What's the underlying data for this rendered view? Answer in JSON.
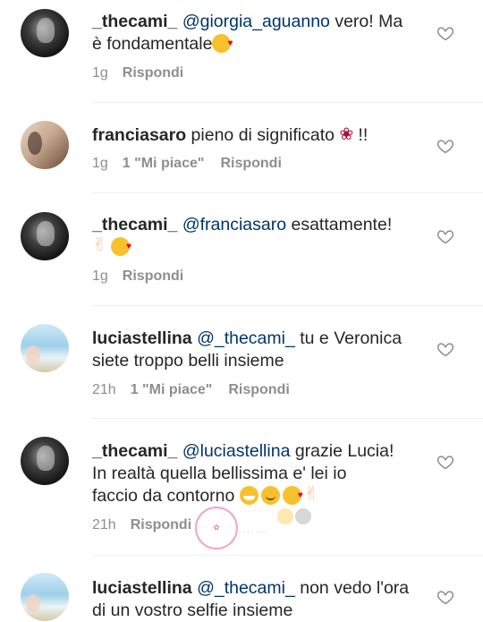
{
  "comments": [
    {
      "username": "_thecami_",
      "mention": "@giorgia_aguanno",
      "text_line1": " vero! Ma",
      "text_line2": "è fondamentale",
      "time": "1g",
      "likes": "",
      "reply": "Rispondi",
      "avatar": "dark"
    },
    {
      "username": "franciasaro",
      "mention": "",
      "text_line1": " pieno di significato ",
      "text_line1_end": "!!",
      "time": "1g",
      "likes": "1 \"Mi piace\"",
      "reply": "Rispondi",
      "avatar": "light"
    },
    {
      "username": "_thecami_",
      "mention": "@franciasaro",
      "text_line1": " esattamente!",
      "time": "1g",
      "likes": "",
      "reply": "Rispondi",
      "avatar": "dark"
    },
    {
      "username": "luciastellina",
      "mention": "@_thecami_",
      "text_line1": " tu e Veronica",
      "text_line2": "siete troppo belli insieme",
      "time": "21h",
      "likes": "1 \"Mi piace\"",
      "reply": "Rispondi",
      "avatar": "sky"
    },
    {
      "username": "_thecami_",
      "mention": "@luciastellina",
      "text_line1": " grazie Lucia!",
      "text_line2": "In realtà quella bellissima e' lei io",
      "text_line3": "faccio da contorno ",
      "time": "21h",
      "likes": "",
      "reply": "Rispondi",
      "avatar": "dark"
    },
    {
      "username": "luciastellina",
      "mention": "@_thecami_",
      "text_line1": " non vedo l'ora",
      "text_line2": "di un vostro selfie insieme",
      "avatar": "sky"
    }
  ],
  "icons": {
    "heart": "heart-outline-icon",
    "emoji_kiss": "face-blowing-kiss-icon",
    "emoji_grin": "grinning-face-icon",
    "emoji_wink": "winking-face-icon",
    "emoji_peace": "victory-hand-icon",
    "emoji_rose": "wilted-rose-icon"
  },
  "colors": {
    "mention": "#003569",
    "meta": "#8e8e8e",
    "text": "#262626",
    "watermark": "#f2a5c4"
  }
}
